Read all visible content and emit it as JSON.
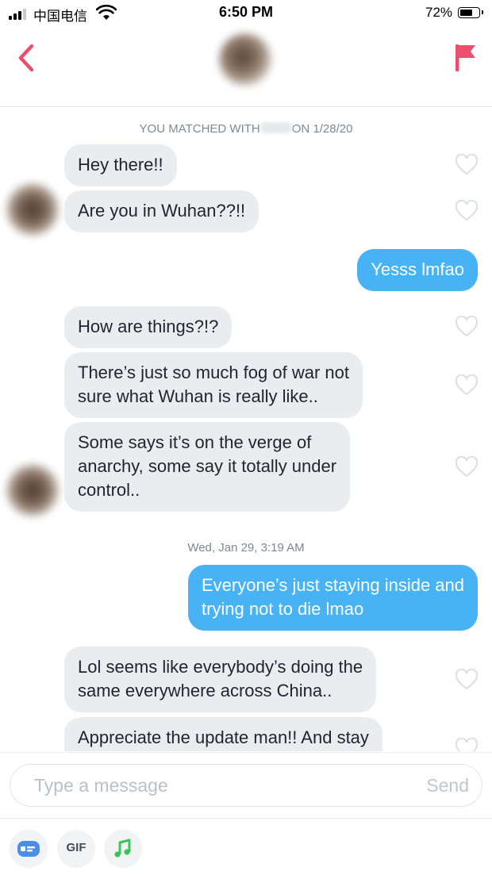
{
  "status_bar": {
    "carrier": "中国电信",
    "time": "6:50 PM",
    "battery_percent": "72%",
    "battery_level": 0.72,
    "signal_bars": 3
  },
  "header": {
    "back_icon": "chevron-left-icon",
    "flag_icon": "flag-icon",
    "accent_color": "#e8506d"
  },
  "chat": {
    "match_notice_prefix": "YOU MATCHED WITH",
    "match_notice_suffix": "ON 1/28/20",
    "date_divider": {
      "day": "Wed, Jan 29,",
      "time": "3:19 AM"
    },
    "messages": [
      {
        "direction": "in",
        "text": "Hey there!!"
      },
      {
        "direction": "in",
        "text": "Are you in Wuhan??!!"
      },
      {
        "direction": "out",
        "text": "Yesss lmfao"
      },
      {
        "direction": "in",
        "text": "How are things?!?"
      },
      {
        "direction": "in",
        "text": "There’s just so much fog of war not\nsure what Wuhan is really like.."
      },
      {
        "direction": "in",
        "text": "Some says it’s on the verge of\nanarchy, some say it totally under\ncontrol.."
      },
      {
        "direction": "out",
        "text": "Everyone’s just staying inside and\ntrying not to die lmao"
      },
      {
        "direction": "in",
        "text": "Lol seems like everybody’s doing the\nsame everywhere across China.."
      },
      {
        "direction": "in",
        "text": "Appreciate the update man!! And stay"
      }
    ],
    "colors": {
      "incoming_bubble": "#eaedf0",
      "outgoing_bubble": "#47b3f5"
    }
  },
  "composer": {
    "placeholder": "Type a message",
    "send_label": "Send"
  },
  "toolbar": {
    "sticker_icon": "sticker-icon",
    "gif_label": "GIF",
    "music_icon": "music-note-icon"
  }
}
